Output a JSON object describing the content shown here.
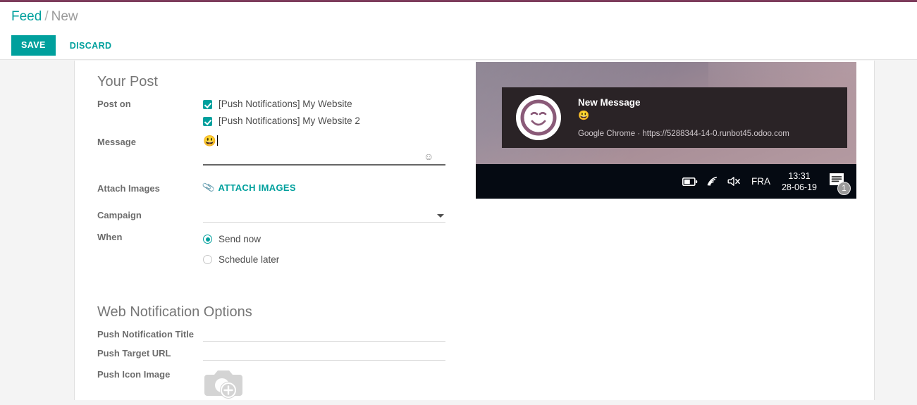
{
  "breadcrumb": {
    "root": "Feed",
    "separator": "/",
    "current": "New"
  },
  "toolbar": {
    "save_label": "SAVE",
    "discard_label": "DISCARD"
  },
  "form": {
    "your_post": {
      "title": "Your Post",
      "post_on": {
        "label": "Post on",
        "options": [
          {
            "label": "[Push Notifications] My Website",
            "checked": true
          },
          {
            "label": "[Push Notifications] My Website 2",
            "checked": true
          }
        ]
      },
      "message": {
        "label": "Message",
        "value": "😃",
        "emoji_picker_icon": "smiley-icon"
      },
      "attach_images": {
        "label": "Attach Images",
        "button_label": "ATTACH IMAGES",
        "icon": "paperclip-icon"
      },
      "campaign": {
        "label": "Campaign",
        "value": "",
        "dropdown_icon": "chevron-down-icon"
      },
      "when": {
        "label": "When",
        "options": [
          {
            "label": "Send now",
            "selected": true
          },
          {
            "label": "Schedule later",
            "selected": false
          }
        ]
      }
    },
    "web_notification_options": {
      "title": "Web Notification Options",
      "push_notification_title": {
        "label": "Push Notification Title",
        "value": ""
      },
      "push_target_url": {
        "label": "Push Target URL",
        "value": ""
      },
      "push_icon_image": {
        "label": "Push Icon Image",
        "placeholder_icon": "camera-add-icon"
      }
    }
  },
  "preview": {
    "notification": {
      "avatar_icon": "smiley-face-avatar",
      "title": "New Message",
      "message": "😃",
      "source": "Google Chrome · https://5288344-14-0.runbot45.odoo.com"
    },
    "taskbar": {
      "battery_icon": "battery-icon",
      "wifi_icon": "wifi-icon",
      "volume_muted_icon": "volume-muted-icon",
      "language": "FRA",
      "time": "13:31",
      "date": "28-06-19",
      "notification_icon": "notification-center-icon",
      "notification_count": "1"
    }
  },
  "colors": {
    "accent": "#00a09d",
    "top_border": "#7d3c5c",
    "label_text": "#6c6c6c",
    "toast_bg": "#2a2326",
    "taskbar_bg": "#050a12"
  }
}
